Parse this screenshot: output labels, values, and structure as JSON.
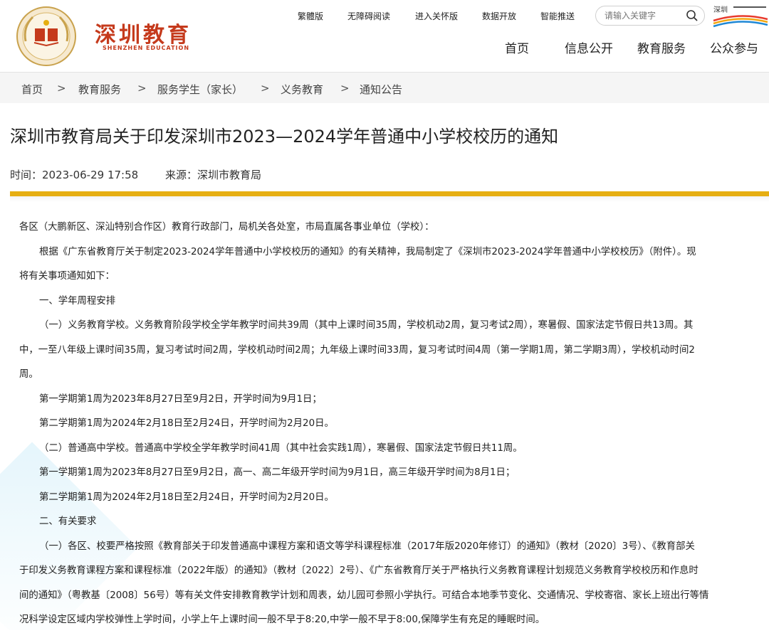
{
  "header": {
    "logo_title": "深圳教育",
    "logo_subtitle": "SHENZHEN EDUCATION",
    "util_links": [
      "繁體版",
      "无障碍阅读",
      "进入关怀版",
      "数据开放",
      "智能推送"
    ],
    "search_placeholder": "请输入关键字",
    "nav": [
      "首页",
      "信息公开",
      "教育服务",
      "公众参与"
    ],
    "brand_badge": "深圳"
  },
  "breadcrumb": {
    "items": [
      "首页",
      "教育服务",
      "服务学生（家长）",
      "义务教育",
      "通知公告"
    ],
    "separator": ">"
  },
  "article": {
    "title": "深圳市教育局关于印发深圳市2023—2024学年普通中小学校校历的通知",
    "time_label": "时间：2023-06-29 17:58",
    "source_label": "来源：深圳市教育局",
    "lines": [
      "各区（大鹏新区、深汕特别合作区）教育行政部门，局机关各处室，市局直属各事业单位（学校）：",
      "根据《广东省教育厅关于制定2023-2024学年普通中小学校校历的通知》的有关精神，我局制定了《深圳市2023-2024学年普通中小学校校历》（附件）。现",
      "将有关事项通知如下：",
      "一、学年周程安排",
      "（一）义务教育学校。义务教育阶段学校全学年教学时间共39周（其中上课时间35周，学校机动2周，复习考试2周），寒暑假、国家法定节假日共13周。其",
      "中，一至八年级上课时间35周，复习考试时间2周，学校机动时间2周；九年级上课时间33周，复习考试时间4周（第一学期1周，第二学期3周），学校机动时间2",
      "周。",
      "第一学期第1周为2023年8月27日至9月2日，开学时间为9月1日；",
      "第二学期第1周为2024年2月18日至2月24日，开学时间为2月20日。",
      "（二）普通高中学校。普通高中学校全学年教学时间41周（其中社会实践1周），寒暑假、国家法定节假日共11周。",
      "第一学期第1周为2023年8月27日至9月2日，高一、高二年级开学时间为9月1日，高三年级开学时间为8月1日；",
      "第二学期第1周为2024年2月18日至2月24日，开学时间为2月20日。",
      "二、有关要求",
      "（一）各区、校要严格按照《教育部关于印发普通高中课程方案和语文等学科课程标准（2017年版2020年修订）的通知》（教材〔2020〕3号）、《教育部关",
      "于印发义务教育课程方案和课程标准（2022年版）的通知》（教材〔2022〕2号）、《广东省教育厅关于严格执行义务教育课程计划规范义务教育学校校历和作息时",
      "间的通知》（粤教基〔2008〕56号）等有关文件安排教育教学计划和周表，幼儿园可参照小学执行。可结合本地季节变化、交通情况、学校寄宿、家长上班出行等情",
      "况科学设定区域内学校弹性上学时间，小学上午上课时间一般不早于8:20,中学一般不早于8:00,保障学生有充足的睡眠时间。"
    ]
  },
  "colors": {
    "accent_gold": "#e6ae12",
    "logo_red": "#c53a1c",
    "breadcrumb_bg": "#f5f5f5"
  }
}
